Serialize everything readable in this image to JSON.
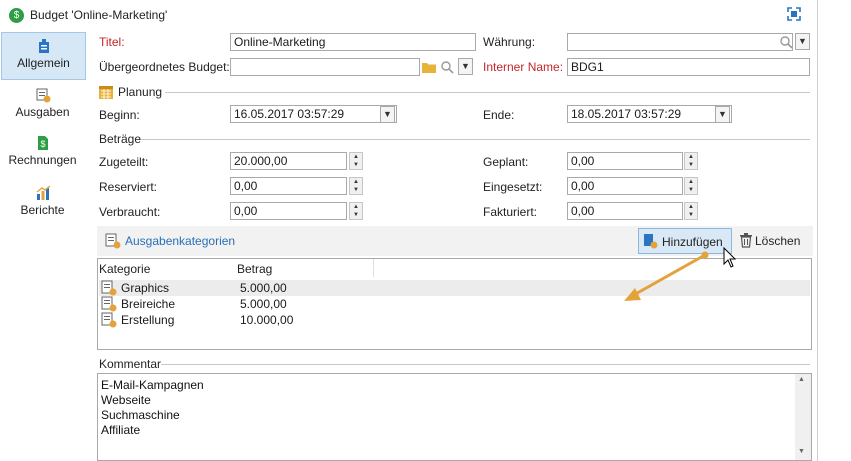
{
  "window": {
    "title": "Budget 'Online-Marketing'"
  },
  "sidebar": {
    "items": [
      {
        "label": "Allgemein",
        "icon": "general-icon",
        "active": true
      },
      {
        "label": "Ausgaben",
        "icon": "expenses-icon"
      },
      {
        "label": "Rechnungen",
        "icon": "invoices-icon"
      },
      {
        "label": "Berichte",
        "icon": "reports-icon"
      }
    ]
  },
  "general": {
    "title_label": "Titel:",
    "title_value": "Online-Marketing",
    "currency_label": "Währung:",
    "currency_value": "",
    "parent_label": "Übergeordnetes Budget:",
    "parent_value": "",
    "internal_label": "Interner Name:",
    "internal_value": "BDG1"
  },
  "planning": {
    "section_label": "Planung",
    "start_label": "Beginn:",
    "start_value": "16.05.2017 03:57:29",
    "end_label": "Ende:",
    "end_value": "18.05.2017 03:57:29"
  },
  "amounts": {
    "section_label": "Beträge",
    "allocated_label": "Zugeteilt:",
    "allocated_value": "20.000,00",
    "reserved_label": "Reserviert:",
    "reserved_value": "0,00",
    "consumed_label": "Verbraucht:",
    "consumed_value": "0,00",
    "planned_label": "Geplant:",
    "planned_value": "0,00",
    "committed_label": "Eingesetzt:",
    "committed_value": "0,00",
    "invoiced_label": "Fakturiert:",
    "invoiced_value": "0,00"
  },
  "categories": {
    "toolbar_label": "Ausgabenkategorien",
    "add_label": "Hinzufügen",
    "delete_label": "Löschen",
    "columns": [
      "Kategorie",
      "Betrag"
    ],
    "rows": [
      {
        "category": "Graphics",
        "amount": "5.000,00"
      },
      {
        "category": "Breireiche",
        "amount": "5.000,00"
      },
      {
        "category": "Erstellung",
        "amount": "10.000,00"
      }
    ]
  },
  "comment": {
    "section_label": "Kommentar",
    "lines": [
      "E-Mail-Kampagnen",
      "Webseite",
      "Suchmaschine",
      "Affiliate"
    ]
  },
  "colors": {
    "accent": "#e3a33a",
    "required_label": "#c3262a",
    "selection": "#d6e7f6"
  }
}
